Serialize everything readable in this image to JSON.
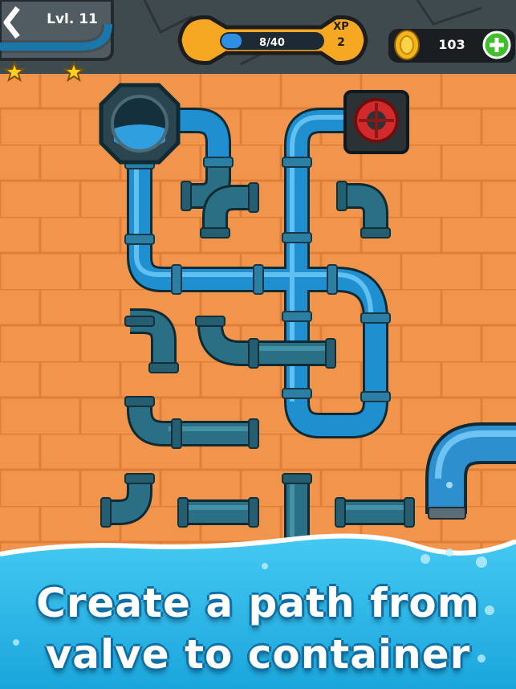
{
  "hud": {
    "level_label": "Lvl. 11",
    "xp_progress_text": "8/40",
    "xp_progress_fraction": 0.2,
    "xp_label": "XP",
    "xp_level": "2",
    "coins": "103",
    "level_stars": 2
  },
  "icons": {
    "back": "chevron-left-icon",
    "coin": "coin-icon",
    "add": "plus-icon",
    "wrench": "wrench-icon",
    "star": "star-icon"
  },
  "board": {
    "source": "water-tank",
    "target": "red-valve"
  },
  "caption": {
    "line1": "Create a path from",
    "line2": "valve to container"
  },
  "colors": {
    "board": "#f2954c",
    "water_pipe": "#1f8fd0",
    "empty_pipe": "#2b6f84",
    "wrench": "#f7a823",
    "sea": "#2fb9ea",
    "add_button": "#3fbf2a"
  }
}
